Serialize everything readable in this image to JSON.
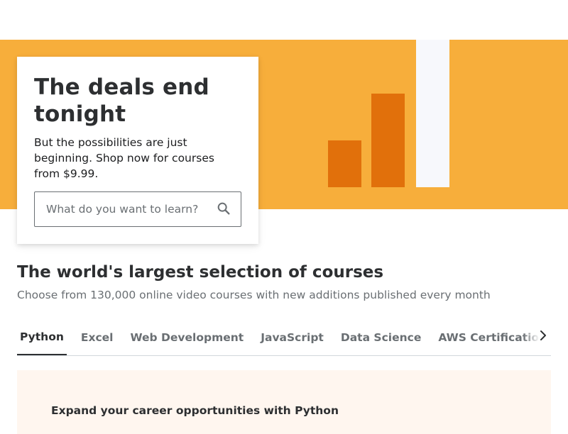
{
  "hero": {
    "title": "The deals end tonight",
    "subtitle": "But the possibilities are just beginning. Shop now for courses from $9.99.",
    "search_placeholder": "What do you want to learn?",
    "search_icon": "search-icon",
    "colors": {
      "background": "#f7ae3b",
      "accent_bars": "#e1700b",
      "light_bar": "#f7f8fc"
    }
  },
  "section": {
    "title": "The world's largest selection of courses",
    "subtitle": "Choose from 130,000 online video courses with new additions published every month"
  },
  "tabs": {
    "items": [
      {
        "label": "Python",
        "active": true
      },
      {
        "label": "Excel",
        "active": false
      },
      {
        "label": "Web Development",
        "active": false
      },
      {
        "label": "JavaScript",
        "active": false
      },
      {
        "label": "Data Science",
        "active": false
      },
      {
        "label": "AWS Certification",
        "active": false
      }
    ],
    "next_icon": "chevron-right-icon"
  },
  "panel": {
    "title": "Expand your career opportunities with Python"
  }
}
